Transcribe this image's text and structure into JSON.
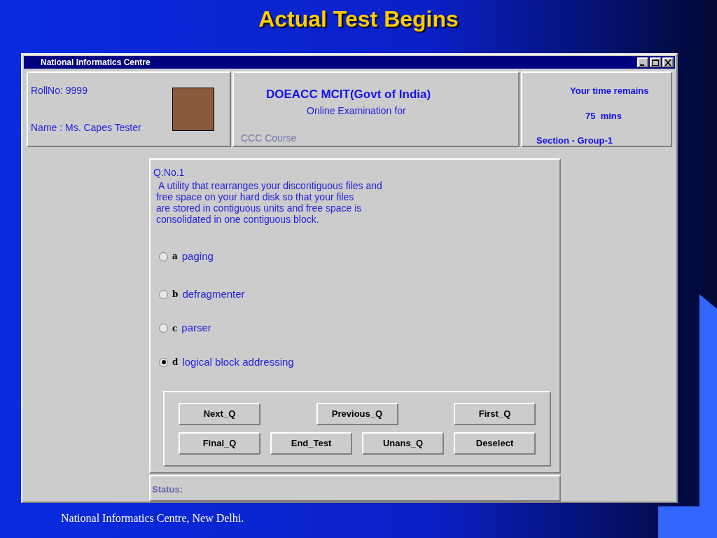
{
  "slide_title": "Actual Test Begins",
  "window": {
    "title": "National Informatics Centre"
  },
  "candidate": {
    "roll_no": "RollNo: 9999",
    "name": "Name : Ms. Capes Tester"
  },
  "exam": {
    "heading": "DOEACC MCIT(Govt of India)",
    "subheading": "Online Examination for",
    "course": "CCC Course"
  },
  "timer": {
    "label": "Your time remains",
    "time": "75  mins",
    "section": "Section - Group-1"
  },
  "question": {
    "number": "Q.No.1",
    "text": "  A utility that rearranges your discontiguous files and\n free space on your hard disk so that your files\n are stored in contiguous units and free space is\n consolidated in one contiguous block."
  },
  "options": [
    {
      "letter": "a",
      "label": "paging",
      "selected": false
    },
    {
      "letter": "b",
      "label": "defragmenter",
      "selected": false
    },
    {
      "letter": "c",
      "label": "parser",
      "selected": false
    },
    {
      "letter": "d",
      "label": "logical block addressing",
      "selected": true
    }
  ],
  "button_rows": [
    [
      "Next_Q",
      "Previous_Q",
      "First_Q"
    ],
    [
      "Final_Q",
      "End_Test",
      "Unans_Q",
      "Deselect"
    ]
  ],
  "status": {
    "label": "Status:"
  },
  "footer": "National Informatics Centre, New Delhi."
}
